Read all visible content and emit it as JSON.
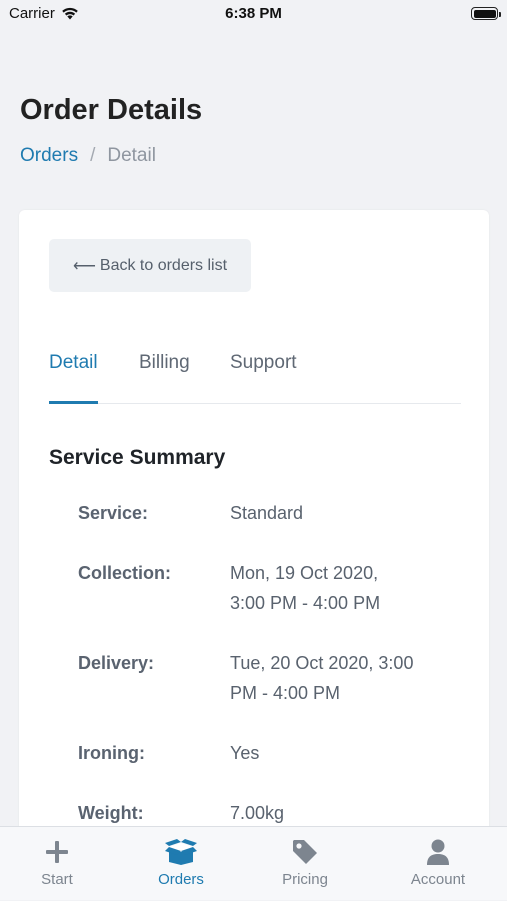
{
  "status_bar": {
    "carrier": "Carrier",
    "time": "6:38 PM"
  },
  "page": {
    "title": "Order Details",
    "breadcrumb": {
      "link": "Orders",
      "separator": "/",
      "current": "Detail"
    }
  },
  "back_button": {
    "arrow": "⟵",
    "label": "Back to orders list"
  },
  "tabs": [
    {
      "label": "Detail",
      "active": true
    },
    {
      "label": "Billing",
      "active": false
    },
    {
      "label": "Support",
      "active": false
    }
  ],
  "summary": {
    "title": "Service Summary",
    "rows": [
      {
        "label": "Service:",
        "value": "Standard"
      },
      {
        "label": "Collection:",
        "value": "Mon, 19 Oct 2020, 3:00 PM - 4:00 PM"
      },
      {
        "label": "Delivery:",
        "value": "Tue, 20 Oct 2020, 3:00 PM - 4:00 PM"
      },
      {
        "label": "Ironing:",
        "value": "Yes"
      },
      {
        "label": "Weight:",
        "value": "7.00kg"
      }
    ]
  },
  "tab_bar": {
    "items": [
      {
        "label": "Start",
        "icon": "plus-icon",
        "active": false
      },
      {
        "label": "Orders",
        "icon": "box-icon",
        "active": true
      },
      {
        "label": "Pricing",
        "icon": "tag-icon",
        "active": false
      },
      {
        "label": "Account",
        "icon": "user-icon",
        "active": false
      }
    ]
  },
  "colors": {
    "accent": "#1f7bb0",
    "background": "#f1f2f5",
    "card": "#ffffff",
    "muted_text": "#7d858f"
  }
}
